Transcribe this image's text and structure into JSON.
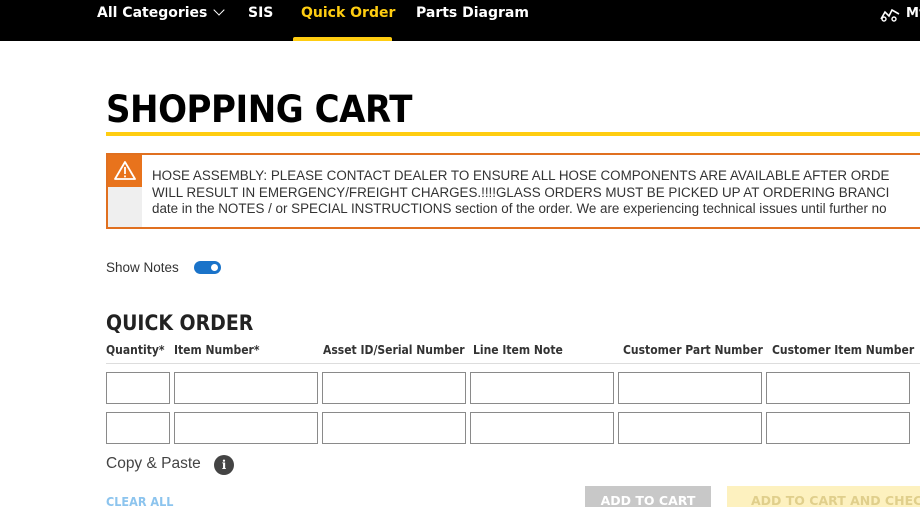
{
  "nav": {
    "items": [
      {
        "label": "All Categories"
      },
      {
        "label": "SIS"
      },
      {
        "label": "Quick Order"
      },
      {
        "label": "Parts Diagram"
      }
    ],
    "my_label": "My"
  },
  "page": {
    "title": "SHOPPING CART"
  },
  "alert": {
    "lines": [
      "HOSE ASSEMBLY: PLEASE CONTACT DEALER TO ENSURE ALL HOSE COMPONENTS ARE AVAILABLE AFTER ORDE",
      "WILL RESULT IN EMERGENCY/FREIGHT CHARGES.!!!!GLASS ORDERS MUST BE PICKED UP AT ORDERING BRANCI",
      "date in the NOTES / or SPECIAL INSTRUCTIONS section of the order. We are experiencing technical issues until further no"
    ],
    "accent_color": "#e8731c"
  },
  "notes": {
    "label": "Show Notes",
    "enabled": true
  },
  "quick_order": {
    "title": "QUICK ORDER",
    "columns": [
      "Quantity*",
      "Item Number*",
      "Asset ID/Serial Number",
      "Line Item Note",
      "Customer Part Number",
      "Customer Item Number"
    ],
    "rows": [
      [
        "",
        "",
        "",
        "",
        "",
        ""
      ],
      [
        "",
        "",
        "",
        "",
        "",
        ""
      ]
    ],
    "copy_paste_label": "Copy & Paste",
    "info_glyph": "i",
    "clear_all": "CLEAR ALL",
    "add_to_cart": "ADD TO CART",
    "add_to_cart_checkout": "ADD TO CART AND CHECKOUT"
  },
  "colors": {
    "brand_yellow": "#ffcd11",
    "toggle_blue": "#1a73c9",
    "nav_bg": "#000000"
  }
}
